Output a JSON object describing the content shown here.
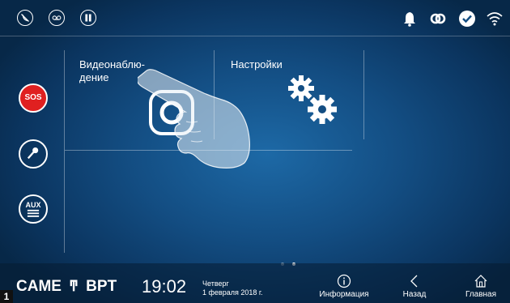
{
  "tiles": [
    {
      "label_line1": "Видеонаблю-",
      "label_line2": "дение",
      "icon": "camera-icon"
    },
    {
      "label": "Настройки",
      "icon": "gears-icon"
    }
  ],
  "side_buttons": {
    "sos": "SOS",
    "key": "key-icon",
    "aux": "AUX"
  },
  "top_left_icons": [
    "intercom-mute-icon",
    "voicemail-icon",
    "do-not-disturb-icon"
  ],
  "top_right_icons": [
    "bell-icon",
    "link-icon",
    "check-icon",
    "wifi-icon"
  ],
  "footer": {
    "brand_came": "CAME",
    "brand_bpt": "BPT",
    "time": "19:02",
    "day": "Четверг",
    "date": "1 февраля 2018 г.",
    "info_label": "Информация",
    "back_label": "Назад",
    "home_label": "Главная"
  },
  "page_indicator": {
    "pages": 2,
    "active": 2
  },
  "corner_badge": "1",
  "colors": {
    "background": "#134d82",
    "sos": "#e02020",
    "text": "#ffffff"
  }
}
